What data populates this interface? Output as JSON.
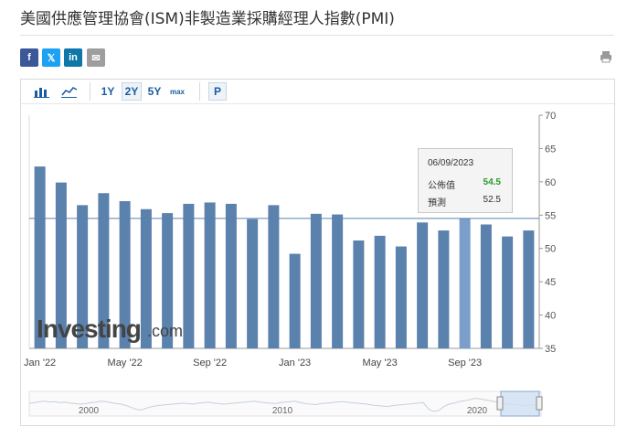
{
  "page": {
    "title": "美國供應管理協會(ISM)非製造業採購經理人指數(PMI)"
  },
  "share": {
    "facebook": "f",
    "twitter": "𝕏",
    "linkedin": "in",
    "email": "✉"
  },
  "toolbar": {
    "r1": "1Y",
    "r2": "2Y",
    "r3": "5Y",
    "r4": "max",
    "p": "P"
  },
  "colors": {
    "bar": "#5b81ad",
    "bar_highlight": "#7b9fca",
    "line": "#5b81ad",
    "axis": "#999999",
    "grid": "#dddddd",
    "text": "#333333",
    "tooltip_value": "#2a9a2a"
  },
  "tooltip": {
    "date": "06/09/2023",
    "actual_label": "公佈值",
    "actual_value": "54.5",
    "forecast_label": "預測",
    "forecast_value": "52.5"
  },
  "watermark": {
    "brand": "Investing",
    "suffix": ".com"
  },
  "chart_data": {
    "type": "bar",
    "x": [
      "Jan '22",
      "Feb '22",
      "Mar '22",
      "Apr '22",
      "May '22",
      "Jun '22",
      "Jul '22",
      "Aug '22",
      "Sep '22",
      "Oct '22",
      "Nov '22",
      "Dec '22",
      "Jan '23",
      "Feb '23",
      "Mar '23",
      "Apr '23",
      "May '23",
      "Jun '23",
      "Jul '23",
      "Aug '23",
      "Sep '23",
      "Oct '23",
      "Nov '23",
      "Dec '23"
    ],
    "values": [
      62.3,
      59.9,
      56.5,
      58.3,
      57.1,
      55.9,
      55.3,
      56.7,
      56.9,
      56.7,
      54.4,
      56.5,
      49.2,
      55.2,
      55.1,
      51.2,
      51.9,
      50.3,
      53.9,
      52.7,
      54.5,
      53.6,
      51.8,
      52.7
    ],
    "highlight_index": 20,
    "reference_line": 54.5,
    "x_ticks": [
      {
        "index": 0,
        "label": "Jan '22"
      },
      {
        "index": 4,
        "label": "May '22"
      },
      {
        "index": 8,
        "label": "Sep '22"
      },
      {
        "index": 12,
        "label": "Jan '23"
      },
      {
        "index": 16,
        "label": "May '23"
      },
      {
        "index": 20,
        "label": "Sep '23"
      }
    ],
    "y_ticks": [
      35,
      40,
      45,
      50,
      55,
      60,
      65,
      70
    ],
    "ylim": [
      35,
      70
    ],
    "y_axis_side": "right",
    "navigator": {
      "labels": [
        "2000",
        "2010",
        "2020"
      ],
      "series": [
        57,
        58,
        60,
        61,
        59,
        60,
        58,
        59,
        57,
        56,
        55,
        56,
        58,
        59,
        61,
        60,
        58,
        56,
        55,
        52,
        48,
        44,
        43,
        47,
        50,
        52,
        53,
        54,
        55,
        56,
        57,
        56,
        55,
        57,
        58,
        59,
        57,
        56,
        55,
        56,
        57,
        58,
        59,
        60,
        61,
        59,
        58,
        57,
        56,
        58,
        59,
        60,
        61,
        58,
        56,
        55,
        54,
        56,
        57,
        58,
        59,
        60,
        59,
        58,
        57,
        56,
        55,
        53,
        52,
        51,
        50,
        52,
        53,
        54,
        55,
        56,
        57,
        58,
        45,
        40,
        42,
        50,
        55,
        57,
        60,
        62,
        64,
        67,
        66,
        64,
        62,
        60,
        58,
        56,
        55,
        54,
        53,
        52,
        54,
        53,
        52
      ]
    }
  }
}
